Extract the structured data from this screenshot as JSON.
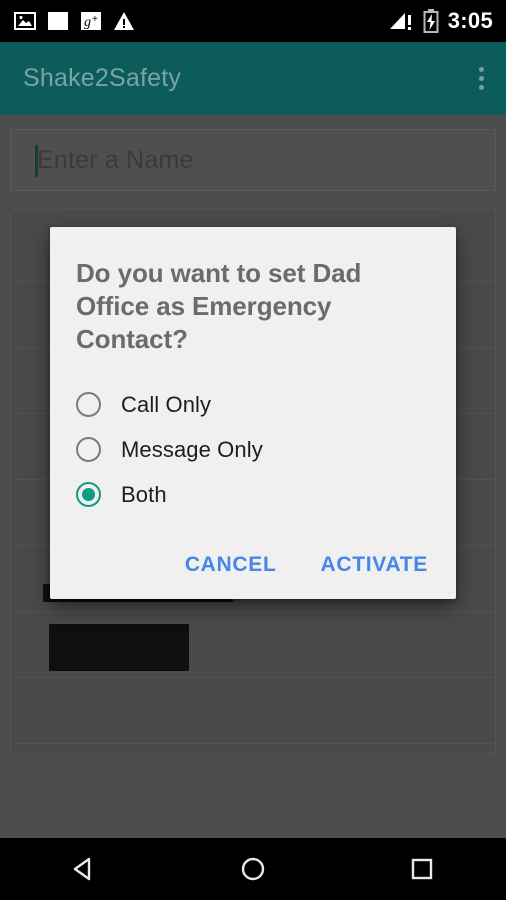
{
  "statusbar": {
    "time": "3:05",
    "icons": [
      "image-icon",
      "blank-square-icon",
      "google-plus-icon",
      "warning-triangle-icon"
    ],
    "right_icons": [
      "signal-warning-icon",
      "battery-charging-icon"
    ]
  },
  "appbar": {
    "title": "Shake2Safety",
    "overflow_label": "overflow-menu",
    "color": "#0c5c5c",
    "title_color": "#7aa3a3"
  },
  "search": {
    "placeholder": "Enter a Name",
    "value": "",
    "caret_color": "#15564f"
  },
  "contact_list": {
    "rows": [
      {
        "label": "",
        "redacted": false
      },
      {
        "label": "",
        "redacted": false
      },
      {
        "label": "",
        "redacted": false
      },
      {
        "label": "",
        "redacted": false
      },
      {
        "label": "",
        "redacted": false
      },
      {
        "label": "",
        "redacted": true
      },
      {
        "label": "",
        "redacted": true
      },
      {
        "label": "",
        "redacted": false
      }
    ]
  },
  "dialog": {
    "title": "Do you want to set Dad Office as Emergency Contact?",
    "contact_name": "Dad Office",
    "options": [
      {
        "label": "Call Only",
        "selected": false
      },
      {
        "label": "Message Only",
        "selected": false
      },
      {
        "label": "Both",
        "selected": true
      }
    ],
    "cancel_label": "CANCEL",
    "activate_label": "ACTIVATE",
    "accent_color": "#0f9b85",
    "button_color": "#4586e8",
    "background": "#f0f0f0"
  },
  "navbar": {
    "back_label": "back-button",
    "home_label": "home-button",
    "recents_label": "recents-button"
  }
}
